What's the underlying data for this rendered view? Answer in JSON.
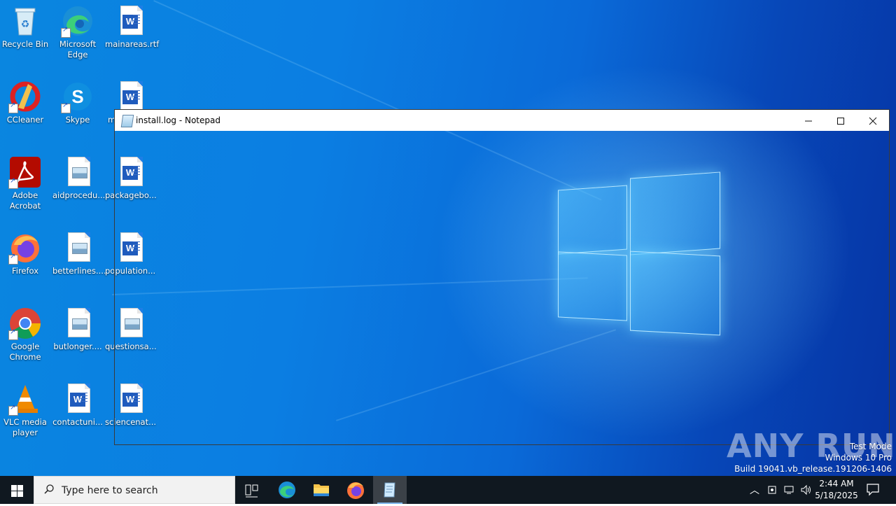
{
  "desktop": {
    "icons": [
      {
        "label": "Recycle Bin"
      },
      {
        "label": "Microsoft Edge"
      },
      {
        "label": "mainareas.rtf"
      },
      {
        "label": "CCleaner"
      },
      {
        "label": "Skype"
      },
      {
        "label": "m"
      },
      {
        "label": "Adobe Acrobat"
      },
      {
        "label": "aidprocedu..."
      },
      {
        "label": "packagebo..."
      },
      {
        "label": "Firefox"
      },
      {
        "label": "betterlines...."
      },
      {
        "label": "population..."
      },
      {
        "label": "Google Chrome"
      },
      {
        "label": "butlonger...."
      },
      {
        "label": "questionsa..."
      },
      {
        "label": "VLC media player"
      },
      {
        "label": "contactuni..."
      },
      {
        "label": "sciencenat..."
      }
    ]
  },
  "notepad": {
    "title": "install.log - Notepad",
    "minimize_icon": "minimize-icon",
    "maximize_icon": "maximize-icon",
    "close_icon": "close-icon"
  },
  "watermark": {
    "brand": "ANY RUN",
    "line1": "Test Mode",
    "line2": "Windows 10 Pro",
    "line3": "Build 19041.vb_release.191206-1406"
  },
  "taskbar": {
    "search_placeholder": "Type here to search",
    "time": "2:44 AM",
    "date": "5/18/2025",
    "apps": [
      "task-view-icon",
      "edge-icon",
      "file-explorer-icon",
      "firefox-icon",
      "notepad-icon"
    ]
  }
}
